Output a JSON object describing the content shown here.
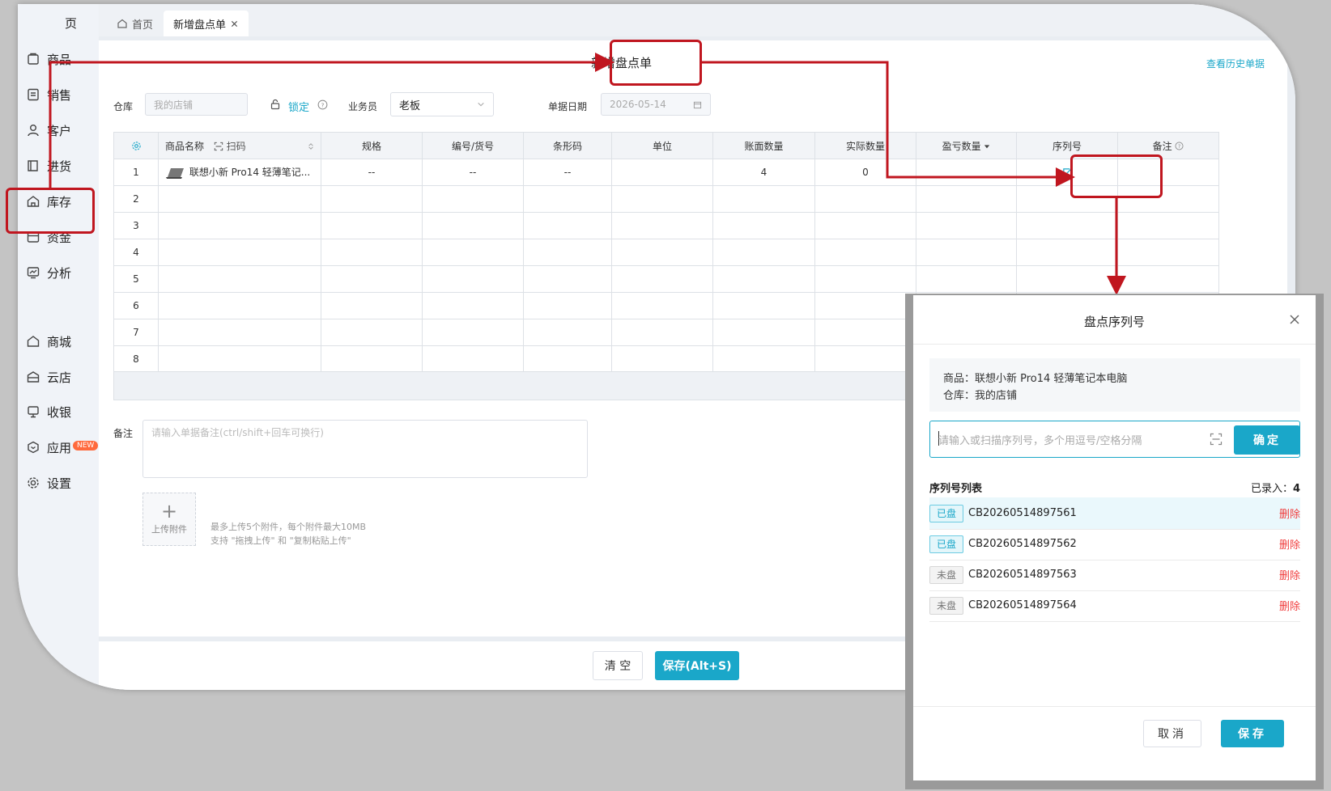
{
  "sidebar": {
    "items": [
      {
        "label": "商品",
        "icon": "product-icon"
      },
      {
        "label": "销售",
        "icon": "sales-icon"
      },
      {
        "label": "客户",
        "icon": "customer-icon"
      },
      {
        "label": "进货",
        "icon": "purchase-icon"
      },
      {
        "label": "库存",
        "icon": "inventory-icon"
      },
      {
        "label": "资金",
        "icon": "finance-icon"
      },
      {
        "label": "分析",
        "icon": "analysis-icon"
      },
      {
        "label": "商城",
        "icon": "mall-icon"
      },
      {
        "label": "云店",
        "icon": "cloud-store-icon"
      },
      {
        "label": "收银",
        "icon": "cashier-icon"
      },
      {
        "label": "应用",
        "icon": "apps-icon"
      },
      {
        "label": "设置",
        "icon": "settings-icon"
      }
    ],
    "partial_top": "页",
    "new_badge": "NEW"
  },
  "tabs": {
    "home": "首页",
    "active": "新增盘点单"
  },
  "header": {
    "title": "新增盘点单",
    "history_link": "查看历史单据"
  },
  "form": {
    "warehouse_label": "仓库",
    "warehouse_value": "我的店铺",
    "lock_label": "锁定",
    "salesman_label": "业务员",
    "salesman_value": "老板",
    "date_label": "单据日期",
    "date_value": "2026-05-14"
  },
  "table": {
    "headers": {
      "name": "商品名称",
      "scan": "扫码",
      "spec": "规格",
      "code": "编号/货号",
      "barcode": "条形码",
      "unit": "单位",
      "book_qty": "账面数量",
      "actual_qty": "实际数量",
      "diff_qty": "盈亏数量",
      "serial": "序列号",
      "remark": "备注"
    },
    "rows": [
      {
        "no": "1",
        "name": "联想小新 Pro14 轻薄笔记...",
        "spec": "--",
        "code": "--",
        "barcode": "--",
        "unit": "",
        "book_qty": "4",
        "actual_qty": "0"
      },
      {
        "no": "2"
      },
      {
        "no": "3"
      },
      {
        "no": "4"
      },
      {
        "no": "5"
      },
      {
        "no": "6"
      },
      {
        "no": "7"
      },
      {
        "no": "8"
      }
    ]
  },
  "remark": {
    "label": "备注",
    "placeholder": "请输入单据备注(ctrl/shift+回车可换行)"
  },
  "upload": {
    "label": "上传附件",
    "hint1": "最多上传5个附件，每个附件最大10MB",
    "hint2": "支持 \"拖拽上传\" 和 \"复制粘贴上传\""
  },
  "footer": {
    "clear_label": "清 空",
    "save_label": "保存(Alt+S)"
  },
  "dialog": {
    "title": "盘点序列号",
    "product_line": "商品：联想小新 Pro14 轻薄笔记本电脑",
    "warehouse_line": "仓库：我的店铺",
    "input_placeholder": "请输入或扫描序列号，多个用逗号/空格分隔",
    "confirm_label": "确定",
    "list_title": "序列号列表",
    "count_label": "已录入：",
    "count_value": "4",
    "serials": [
      {
        "status": "已盘",
        "done": true,
        "code": "CB20260514897561",
        "action": "删除"
      },
      {
        "status": "已盘",
        "done": true,
        "code": "CB20260514897562",
        "action": "删除"
      },
      {
        "status": "未盘",
        "done": false,
        "code": "CB20260514897563",
        "action": "删除"
      },
      {
        "status": "未盘",
        "done": false,
        "code": "CB20260514897564",
        "action": "删除"
      }
    ],
    "cancel_label": "取消",
    "save_label": "保存"
  },
  "colors": {
    "accent": "#1aa7c9",
    "annotation": "#c0161f",
    "danger": "#f03d3d"
  }
}
